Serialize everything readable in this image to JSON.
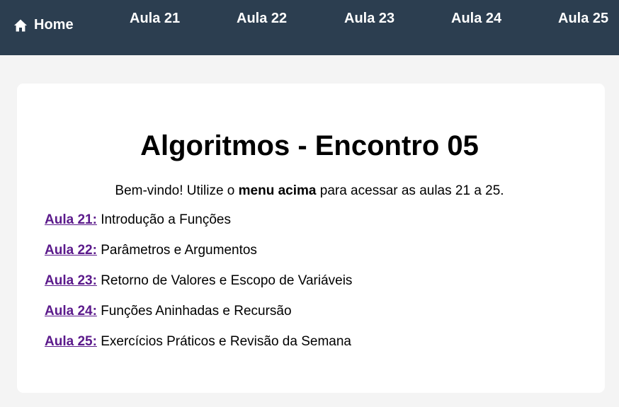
{
  "nav": {
    "home_label": "Home",
    "home_icon": "home-icon",
    "links": [
      {
        "label": "Aula 21"
      },
      {
        "label": "Aula 22"
      },
      {
        "label": "Aula 23"
      },
      {
        "label": "Aula 24"
      },
      {
        "label": "Aula 25"
      }
    ],
    "background_color": "#2c3e50"
  },
  "main": {
    "title": "Algoritmos - Encontro 05",
    "intro_before": "Bem-vindo! Utilize o ",
    "intro_bold": "menu acima",
    "intro_after": " para acessar as aulas 21 a 25.",
    "lessons": [
      {
        "link": "Aula 21:",
        "description": " Introdução a Funções"
      },
      {
        "link": "Aula 22:",
        "description": " Parâmetros e Argumentos"
      },
      {
        "link": "Aula 23:",
        "description": " Retorno de Valores e Escopo de Variáveis"
      },
      {
        "link": "Aula 24:",
        "description": " Funções Aninhadas e Recursão"
      },
      {
        "link": "Aula 25:",
        "description": " Exercícios Práticos e Revisão da Semana"
      }
    ],
    "link_color": "#5b1a8b"
  }
}
